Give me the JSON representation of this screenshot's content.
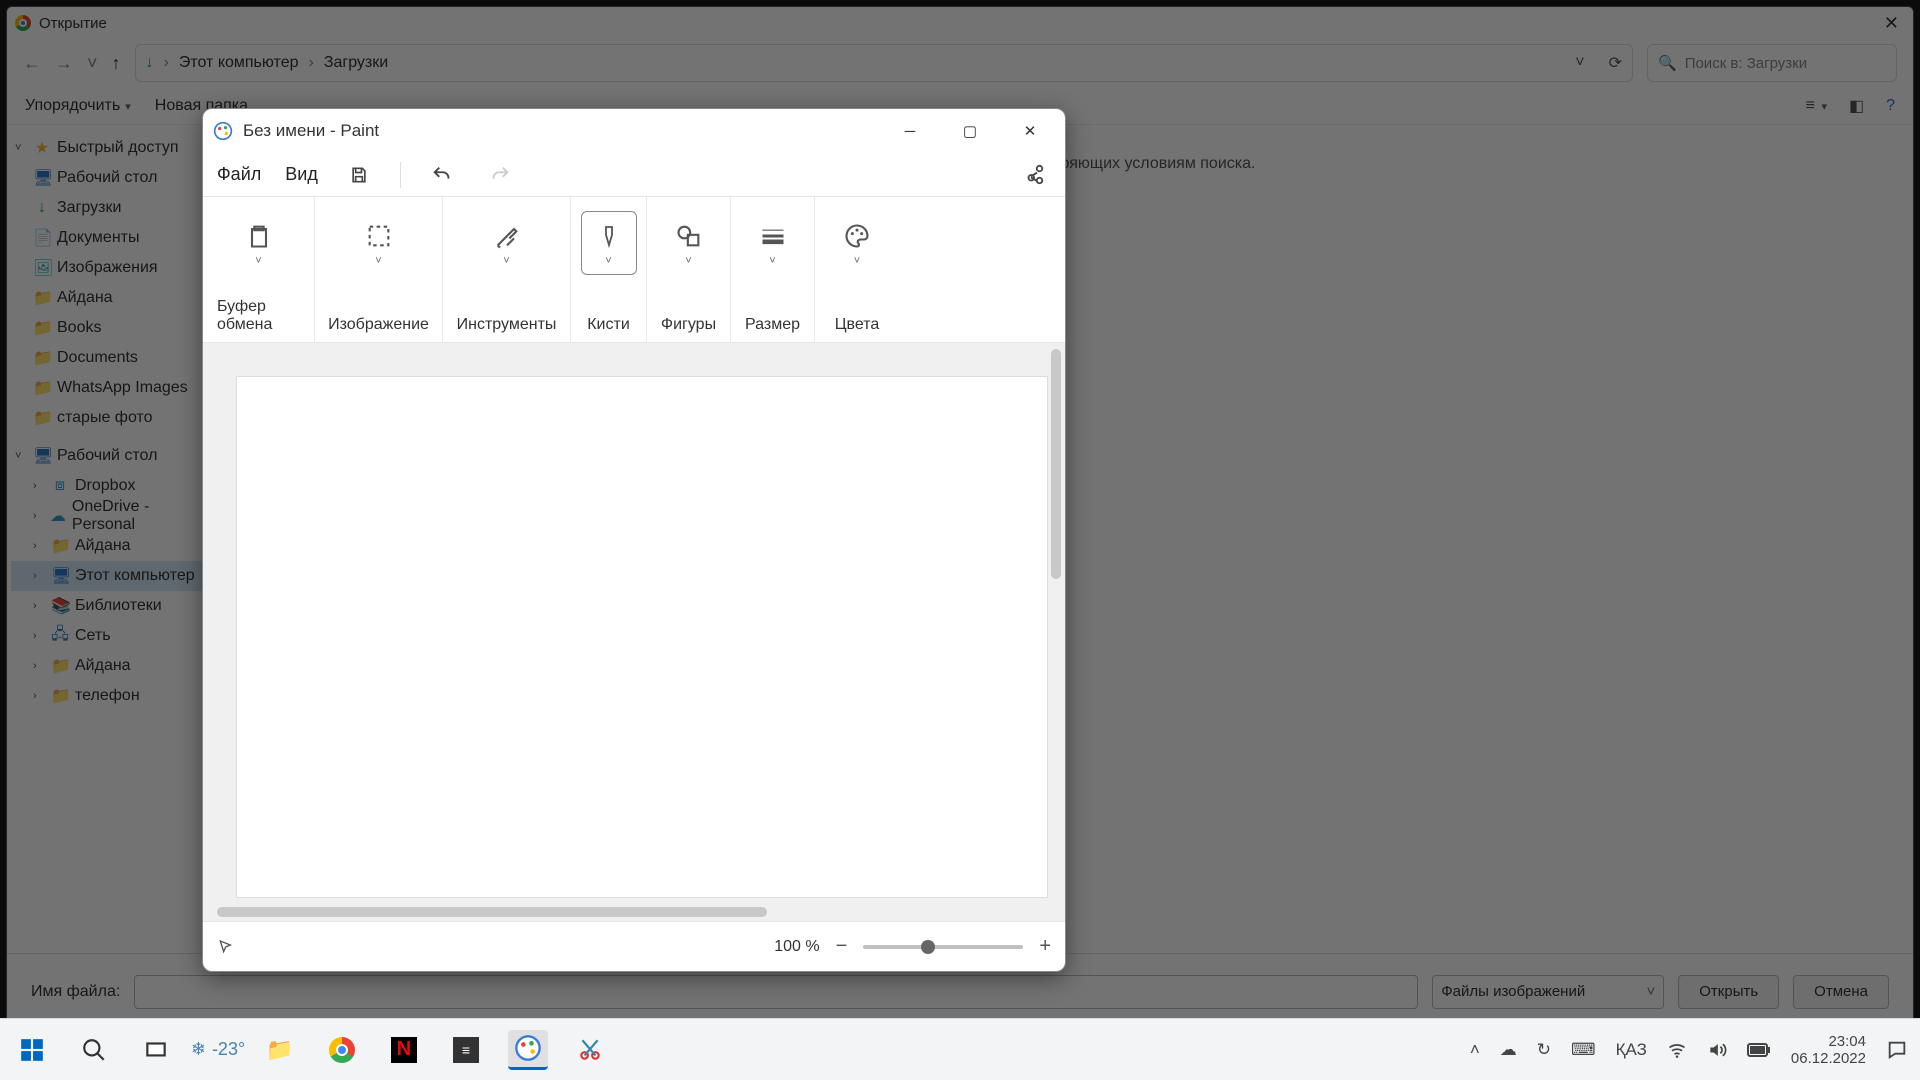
{
  "open_dialog": {
    "title": "Открытие",
    "breadcrumb": {
      "root": "Этот компьютер",
      "folder": "Загрузки"
    },
    "search_placeholder": "Поиск в: Загрузки",
    "toolbar": {
      "organize": "Упорядочить",
      "new_folder": "Новая папка"
    },
    "tree": {
      "quick": "Быстрый доступ",
      "desktop": "Рабочий стол",
      "downloads": "Загрузки",
      "documents": "Документы",
      "pictures": "Изображения",
      "aidana": "Айдана",
      "books": "Books",
      "docs": "Documents",
      "whatsapp": "WhatsApp Images",
      "oldphotos": "старые фото",
      "desktop2": "Рабочий стол",
      "dropbox": "Dropbox",
      "onedrive": "OneDrive - Personal",
      "aidana2": "Айдана",
      "thispc": "Этот компьютер",
      "libs": "Библиотеки",
      "network": "Сеть",
      "aidana3": "Айдана",
      "phone": "телефон"
    },
    "empty_text": "Нет элементов, удовлетворяющих условиям поиска.",
    "filename_label": "Имя файла:",
    "filetype": "Файлы изображений",
    "btn_open": "Открыть",
    "btn_cancel": "Отмена"
  },
  "paint": {
    "title": "Без имени - Paint",
    "menu_file": "Файл",
    "menu_view": "Вид",
    "ribbon": {
      "clipboard": "Буфер обмена",
      "image": "Изображение",
      "tools": "Инструменты",
      "brushes": "Кисти",
      "shapes": "Фигуры",
      "size": "Размер",
      "colors": "Цвета"
    },
    "zoom": "100 %"
  },
  "taskbar": {
    "weather": "-23°",
    "lang": "ҚАЗ",
    "time": "23:04",
    "date": "06.12.2022"
  }
}
